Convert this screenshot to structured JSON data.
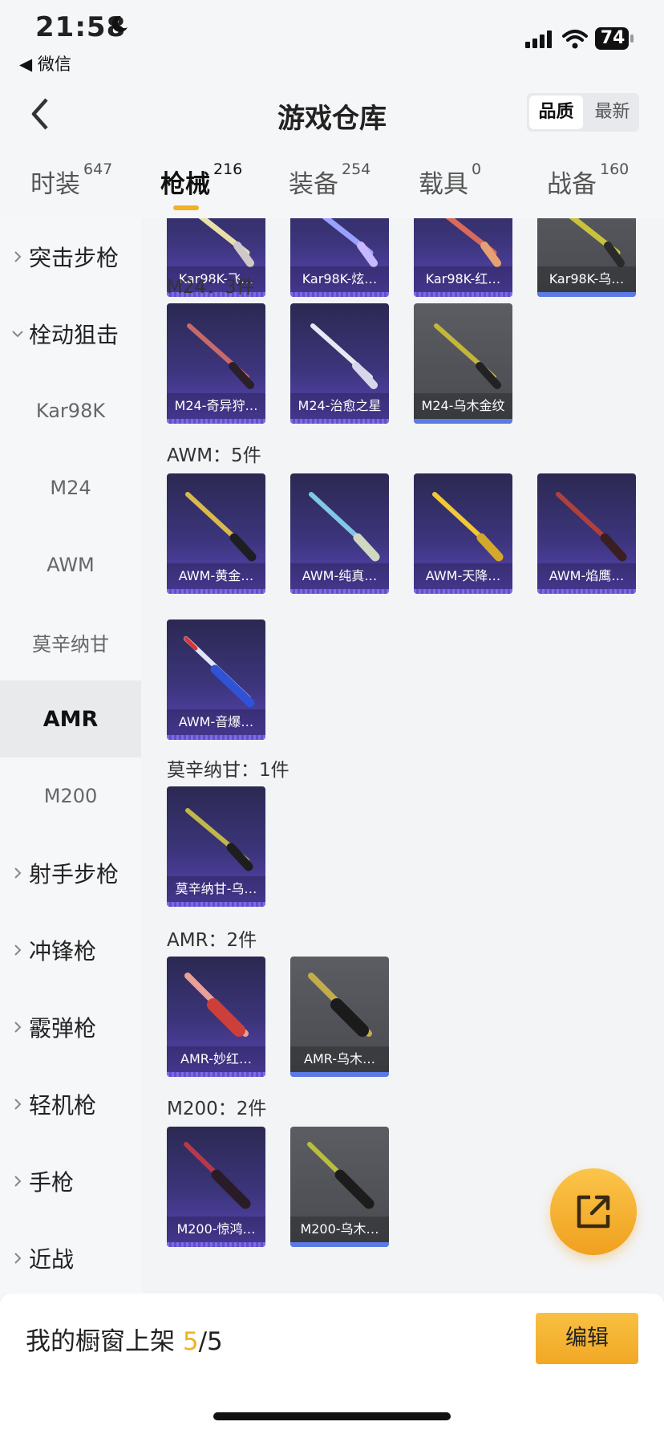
{
  "status": {
    "time": "21:58",
    "back_app": "◀ 微信",
    "battery": "74"
  },
  "nav": {
    "title": "游戏仓库",
    "sort_options": [
      "品质",
      "最新"
    ]
  },
  "tabs": [
    {
      "label": "时装",
      "count": "647"
    },
    {
      "label": "枪械",
      "count": "216"
    },
    {
      "label": "装备",
      "count": "254"
    },
    {
      "label": "载具",
      "count": "0"
    },
    {
      "label": "战备",
      "count": "160"
    }
  ],
  "sidebar": [
    {
      "label": "突击步枪"
    },
    {
      "label": "栓动狙击"
    },
    {
      "label": "Kar98K"
    },
    {
      "label": "M24"
    },
    {
      "label": "AWM"
    },
    {
      "label": "莫辛纳甘"
    },
    {
      "label": "AMR"
    },
    {
      "label": "M200"
    },
    {
      "label": "射手步枪"
    },
    {
      "label": "冲锋枪"
    },
    {
      "label": "霰弹枪"
    },
    {
      "label": "轻机枪"
    },
    {
      "label": "手枪"
    },
    {
      "label": "近战"
    }
  ],
  "sections": [
    {
      "title": "",
      "items": [
        "Kar98K-飞…",
        "Kar98K-炫…",
        "Kar98K-红…",
        "Kar98K-乌…"
      ]
    },
    {
      "title": "M24：3件",
      "items": [
        "M24-奇异狩…",
        "M24-治愈之星",
        "M24-乌木金纹"
      ]
    },
    {
      "title": "AWM：5件",
      "items": [
        "AWM-黄金…",
        "AWM-纯真…",
        "AWM-天降…",
        "AWM-焰鹰…",
        "AWM-音爆…"
      ]
    },
    {
      "title": "莫辛纳甘：1件",
      "items": [
        "莫辛纳甘-乌…"
      ]
    },
    {
      "title": "AMR：2件",
      "items": [
        "AMR-妙红…",
        "AMR-乌木…"
      ]
    },
    {
      "title": "M200：2件",
      "items": [
        "M200-惊鸿…",
        "M200-乌木…"
      ]
    }
  ],
  "bottom": {
    "label": "我的橱窗上架",
    "current": "5",
    "total": "/5",
    "edit": "编辑"
  },
  "colors": {
    "accent": "#f0b323",
    "card_purple": "#3c357c",
    "card_gray": "#4d4f54"
  },
  "icons": [
    "moon-icon",
    "signal-icon",
    "wifi-icon",
    "battery-icon",
    "back-arrow-icon",
    "chevron-right-icon",
    "chevron-down-icon",
    "share-external-icon"
  ]
}
